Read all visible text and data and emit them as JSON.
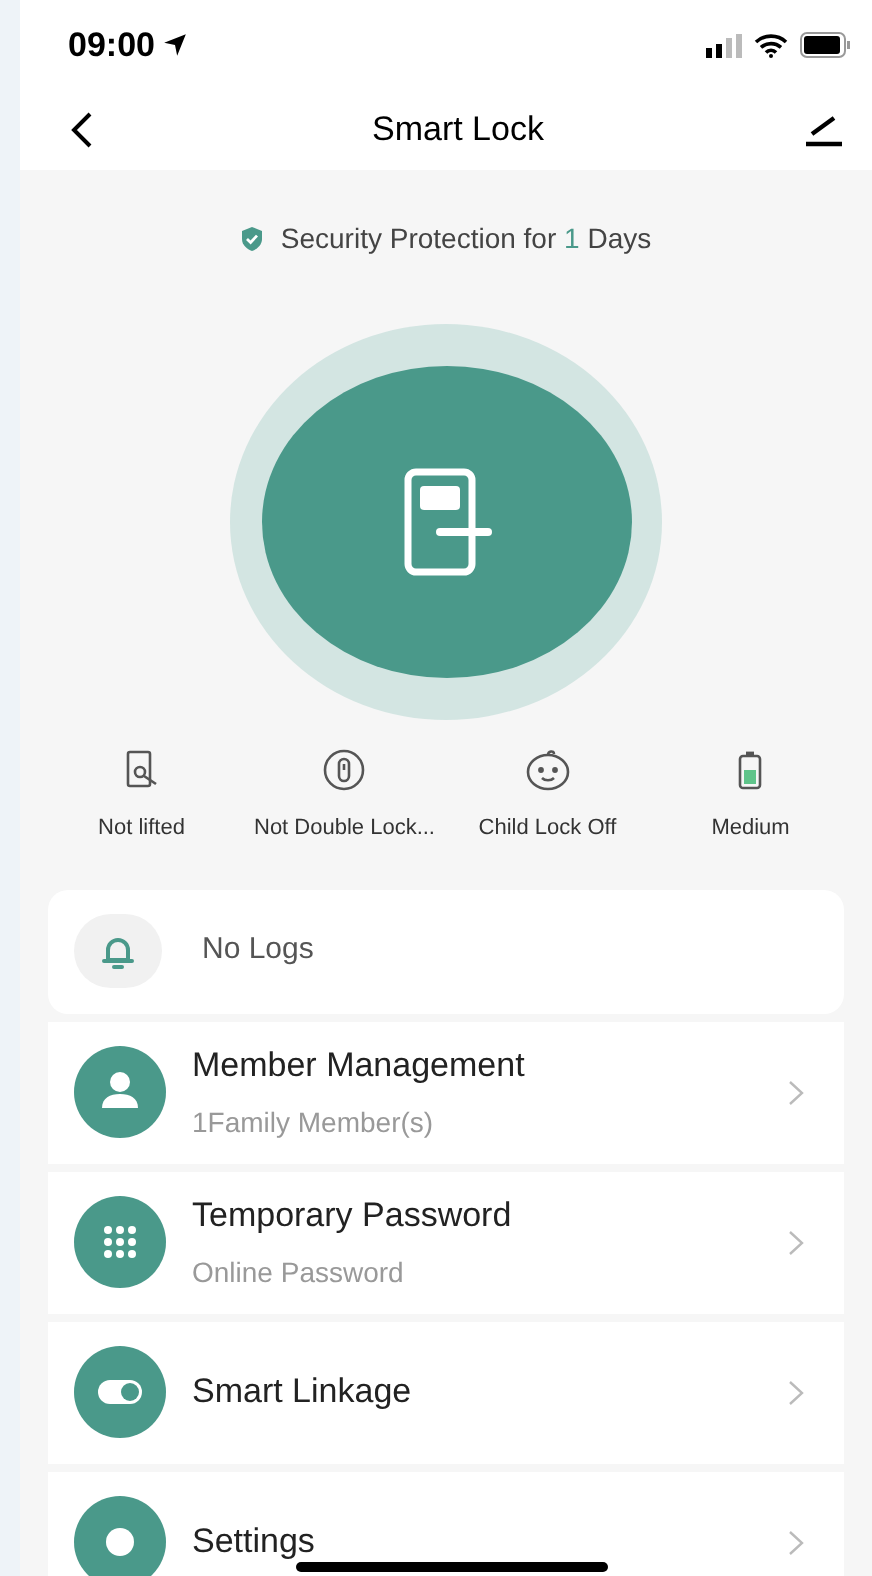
{
  "status_bar": {
    "time": "09:00"
  },
  "header": {
    "title": "Smart Lock"
  },
  "protection": {
    "prefix": "Security Protection for ",
    "count": "1",
    "suffix": " Days"
  },
  "lock_status": [
    {
      "kind": "lifted",
      "label": "Not lifted"
    },
    {
      "kind": "double_lock",
      "label": "Not Double Lock..."
    },
    {
      "kind": "child_lock",
      "label": "Child Lock Off"
    },
    {
      "kind": "battery",
      "label": "Medium"
    }
  ],
  "logs": {
    "label": "No Logs"
  },
  "menu": [
    {
      "kind": "member",
      "title": "Member Management",
      "subtitle": "1Family Member(s)"
    },
    {
      "kind": "password",
      "title": "Temporary Password",
      "subtitle": "Online Password"
    },
    {
      "kind": "linkage",
      "title": "Smart Linkage"
    },
    {
      "kind": "settings",
      "title": "Settings"
    }
  ]
}
